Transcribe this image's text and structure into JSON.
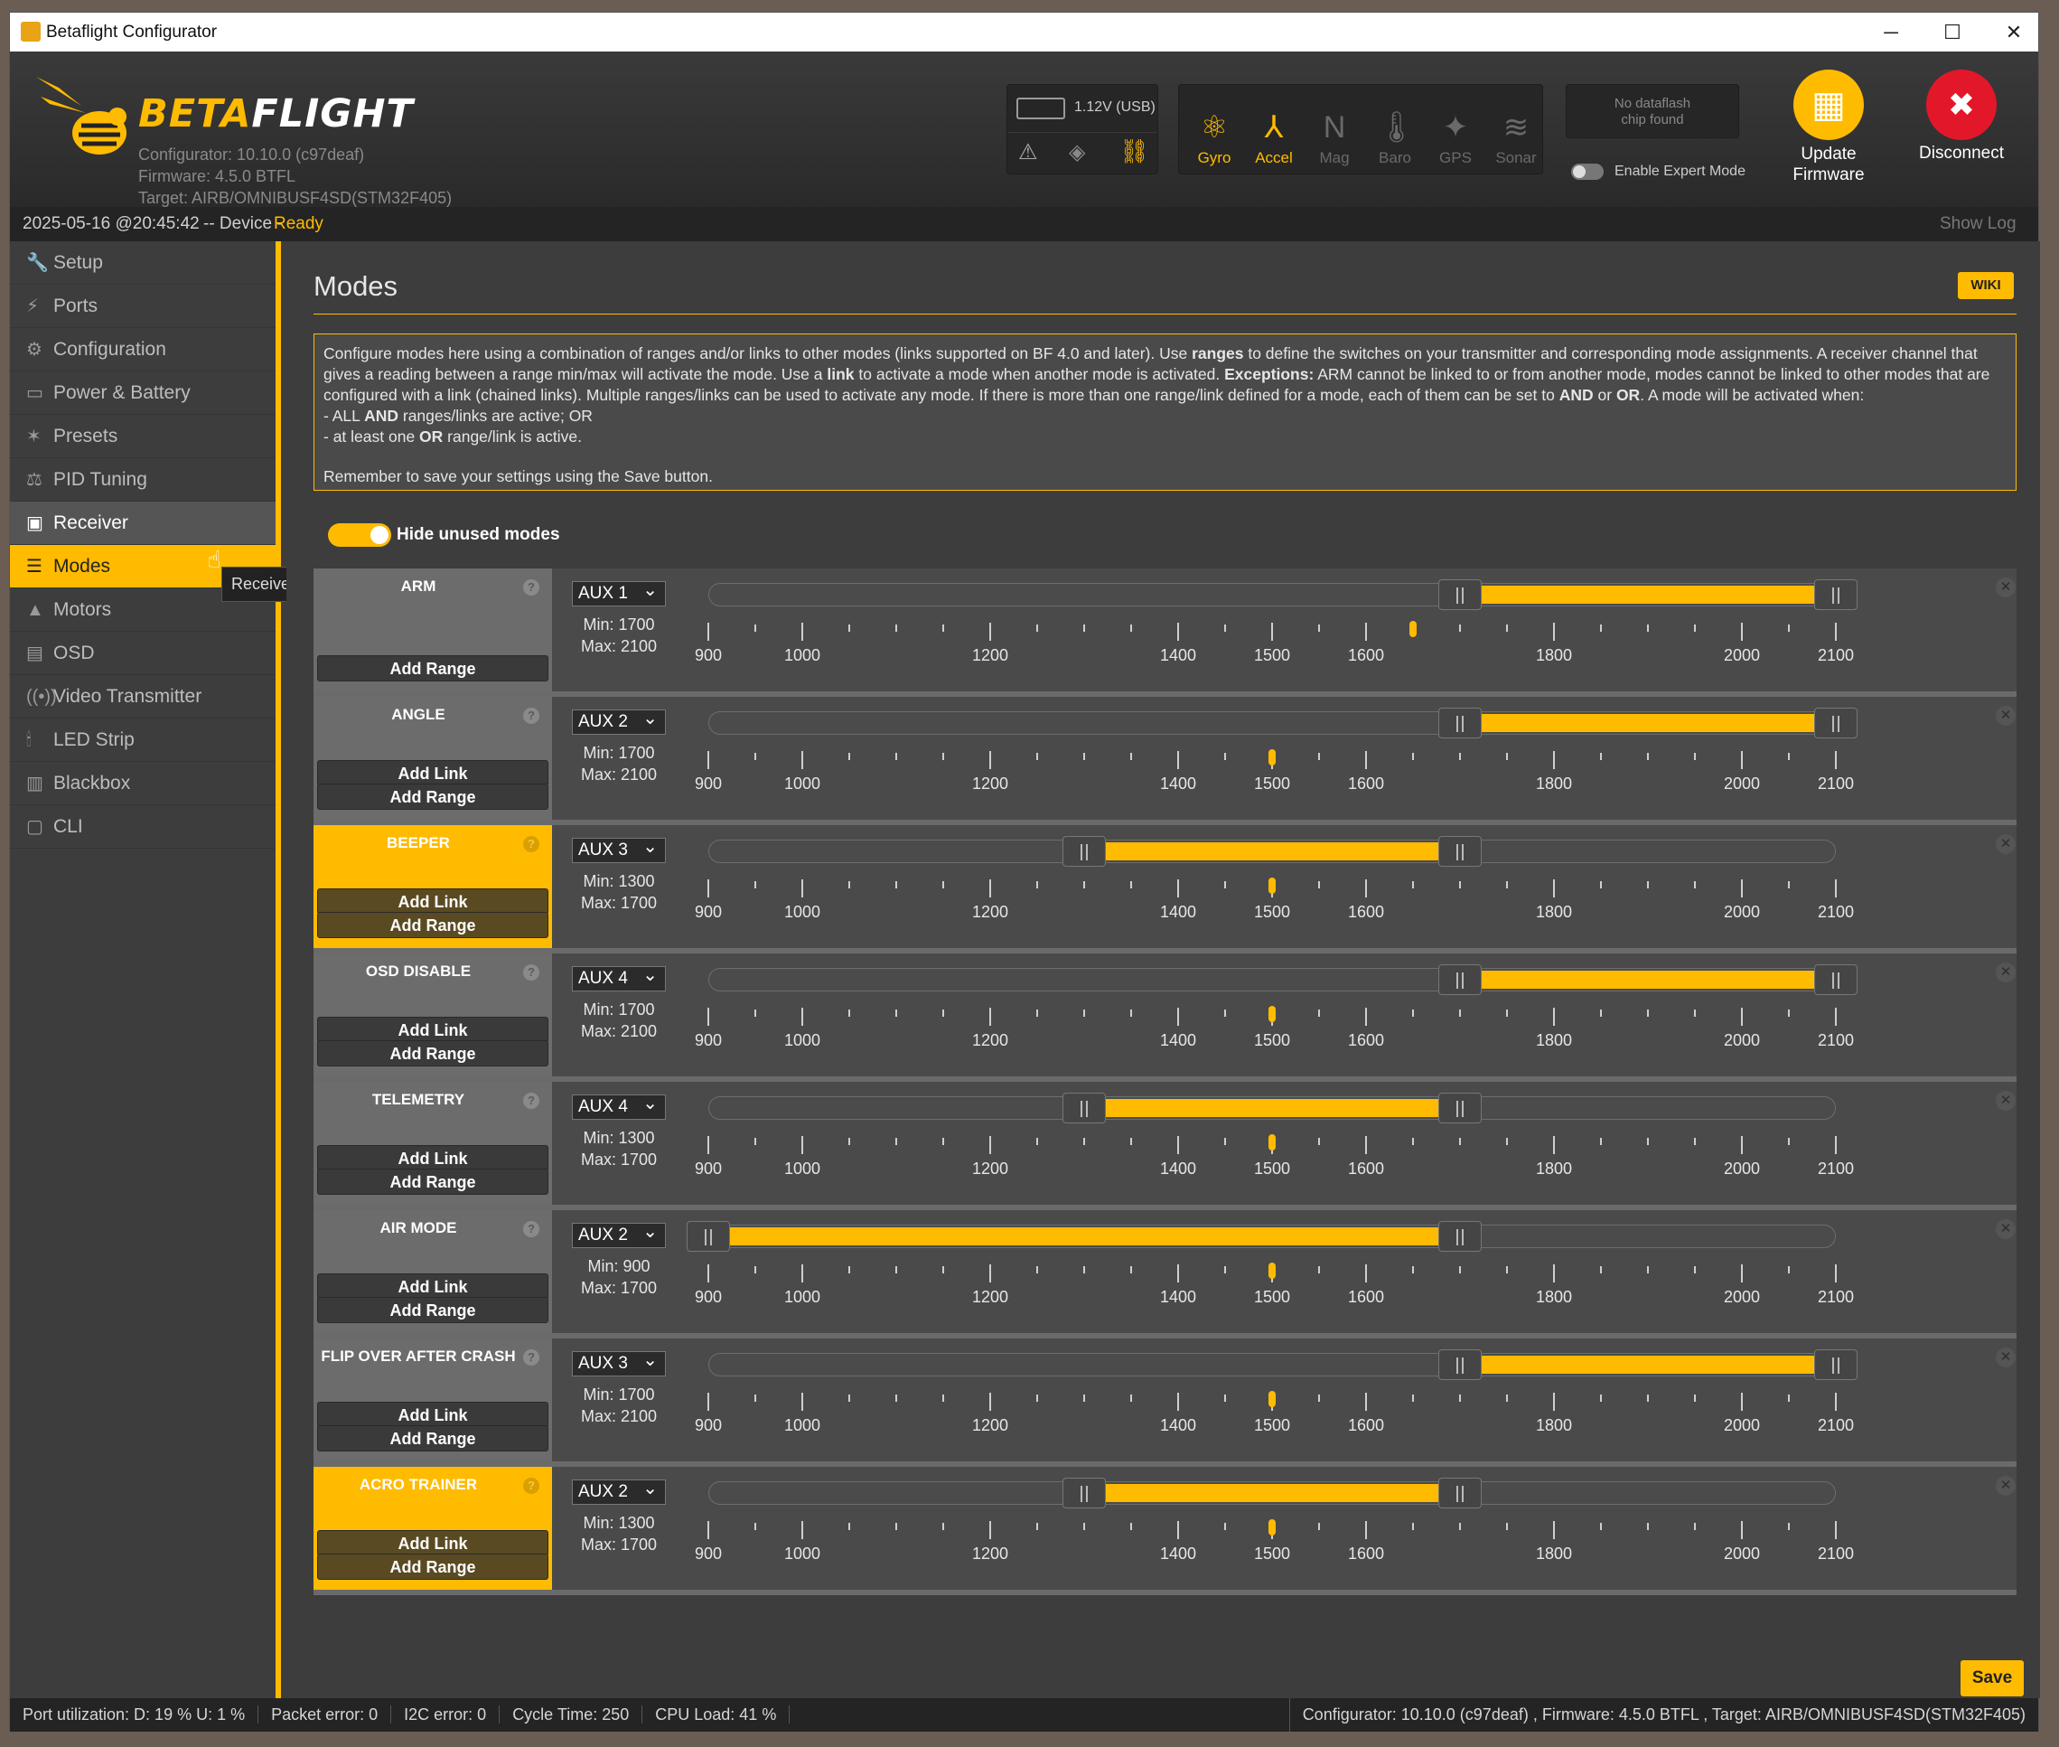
{
  "window": {
    "title": "Betaflight Configurator",
    "minimize": "─",
    "maximize": "☐",
    "close": "✕"
  },
  "header": {
    "brand_part1": "BETA",
    "brand_part2": "FLIGHT",
    "configurator_version": "Configurator: 10.10.0 (c97deaf)",
    "firmware_version": "Firmware: 4.5.0 BTFL",
    "target": "Target: AIRB/OMNIBUSF4SD(STM32F405)",
    "battery_voltage": "1.12V (USB)",
    "sensors": [
      {
        "label": "Gyro",
        "icon": "gyro-icon",
        "active": true
      },
      {
        "label": "Accel",
        "icon": "accel-icon",
        "active": true
      },
      {
        "label": "Mag",
        "icon": "mag-icon",
        "active": false
      },
      {
        "label": "Baro",
        "icon": "baro-icon",
        "active": false
      },
      {
        "label": "GPS",
        "icon": "gps-icon",
        "active": false
      },
      {
        "label": "Sonar",
        "icon": "sonar-icon",
        "active": false
      }
    ],
    "dataflash_line1": "No dataflash",
    "dataflash_line2": "chip found",
    "expert_mode_label": "Enable Expert Mode",
    "update_firmware_line1": "Update",
    "update_firmware_line2": "Firmware",
    "disconnect_label": "Disconnect"
  },
  "status": {
    "timestamp": "2025-05-16 @20:45:42",
    "separator": "-- Device -",
    "device_state": "Ready",
    "show_log": "Show Log"
  },
  "sidebar": {
    "items": [
      {
        "label": "Setup",
        "icon": "wrench-icon"
      },
      {
        "label": "Ports",
        "icon": "plug-icon"
      },
      {
        "label": "Configuration",
        "icon": "gear-icon"
      },
      {
        "label": "Power & Battery",
        "icon": "battery-icon"
      },
      {
        "label": "Presets",
        "icon": "presets-icon"
      },
      {
        "label": "PID Tuning",
        "icon": "pid-icon"
      },
      {
        "label": "Receiver",
        "icon": "receiver-icon"
      },
      {
        "label": "Modes",
        "icon": "modes-icon"
      },
      {
        "label": "Motors",
        "icon": "motor-icon"
      },
      {
        "label": "OSD",
        "icon": "osd-icon"
      },
      {
        "label": "Video Transmitter",
        "icon": "vtx-icon"
      },
      {
        "label": "LED Strip",
        "icon": "led-icon"
      },
      {
        "label": "Blackbox",
        "icon": "blackbox-icon"
      },
      {
        "label": "CLI",
        "icon": "cli-icon"
      }
    ],
    "tooltip": "Receiver"
  },
  "main": {
    "title": "Modes",
    "wiki": "WIKI",
    "note_p1a": "Configure modes here using a combination of ranges and/or links to other modes (links supported on BF 4.0 and later). Use ",
    "note_ranges": "ranges",
    "note_p1b": " to define the switches on your transmitter and corresponding mode assignments. A receiver channel that gives a reading between a range min/max will activate the mode. Use a ",
    "note_link": "link",
    "note_p1c": " to activate a mode when another mode is activated. ",
    "note_exceptions": "Exceptions:",
    "note_p1d": " ARM cannot be linked to or from another mode, modes cannot be linked to other modes that are configured with a link (chained links). Multiple ranges/links can be used to activate any mode. If there is more than one range/link defined for a mode, each of them can be set to ",
    "note_and": "AND",
    "note_or_word": " or ",
    "note_or": "OR",
    "note_p1e": ". A mode will be activated when:",
    "note_l1a": "- ALL ",
    "note_l1b": "AND",
    "note_l1c": " ranges/links are active; OR",
    "note_l2a": "- at least one ",
    "note_l2b": "OR",
    "note_l2c": " range/link is active.",
    "note_save": "Remember to save your settings using the Save button.",
    "hide_unused": "Hide unused modes",
    "save": "Save"
  },
  "scale_labels": [
    "900",
    "1000",
    "1200",
    "1400",
    "1500",
    "1600",
    "1800",
    "2000",
    "2100"
  ],
  "modes": [
    {
      "name": "ARM",
      "aux": "AUX 1",
      "min": "Min: 1700",
      "max": "Max: 2100",
      "min_value": 1700,
      "max_value": 2100,
      "channel_value": 1650,
      "active": false,
      "has_link": false,
      "link_label": "",
      "range_label": "Add Range"
    },
    {
      "name": "ANGLE",
      "aux": "AUX 2",
      "min": "Min: 1700",
      "max": "Max: 2100",
      "min_value": 1700,
      "max_value": 2100,
      "channel_value": 1500,
      "active": false,
      "has_link": true,
      "link_label": "Add Link",
      "range_label": "Add Range"
    },
    {
      "name": "BEEPER",
      "aux": "AUX 3",
      "min": "Min: 1300",
      "max": "Max: 1700",
      "min_value": 1300,
      "max_value": 1700,
      "channel_value": 1500,
      "active": true,
      "has_link": true,
      "link_label": "Add Link",
      "range_label": "Add Range"
    },
    {
      "name": "OSD DISABLE",
      "aux": "AUX 4",
      "min": "Min: 1700",
      "max": "Max: 2100",
      "min_value": 1700,
      "max_value": 2100,
      "channel_value": 1500,
      "active": false,
      "has_link": true,
      "link_label": "Add Link",
      "range_label": "Add Range"
    },
    {
      "name": "TELEMETRY",
      "aux": "AUX 4",
      "min": "Min: 1300",
      "max": "Max: 1700",
      "min_value": 1300,
      "max_value": 1700,
      "channel_value": 1500,
      "active": false,
      "has_link": true,
      "link_label": "Add Link",
      "range_label": "Add Range"
    },
    {
      "name": "AIR MODE",
      "aux": "AUX 2",
      "min": "Min: 900",
      "max": "Max: 1700",
      "min_value": 900,
      "max_value": 1700,
      "channel_value": 1500,
      "active": false,
      "has_link": true,
      "link_label": "Add Link",
      "range_label": "Add Range"
    },
    {
      "name": "FLIP OVER AFTER CRASH",
      "aux": "AUX 3",
      "min": "Min: 1700",
      "max": "Max: 2100",
      "min_value": 1700,
      "max_value": 2100,
      "channel_value": 1500,
      "active": false,
      "has_link": true,
      "link_label": "Add Link",
      "range_label": "Add Range"
    },
    {
      "name": "ACRO TRAINER",
      "aux": "AUX 2",
      "min": "Min: 1300",
      "max": "Max: 1700",
      "min_value": 1300,
      "max_value": 1700,
      "channel_value": 1500,
      "active": true,
      "has_link": true,
      "link_label": "Add Link",
      "range_label": "Add Range"
    }
  ],
  "footer": {
    "port_util": "Port utilization: D: 19 % U: 1 %",
    "packet_error": "Packet error: 0",
    "i2c_error": "I2C error: 0",
    "cycle_time": "Cycle Time: 250",
    "cpu_load": "CPU Load: 41 %",
    "versions": "Configurator: 10.10.0 (c97deaf) , Firmware: 4.5.0 BTFL , Target: AIRB/OMNIBUSF4SD(STM32F405)"
  },
  "colors": {
    "accent": "#ffbb00",
    "disconnect": "#e3172a"
  }
}
